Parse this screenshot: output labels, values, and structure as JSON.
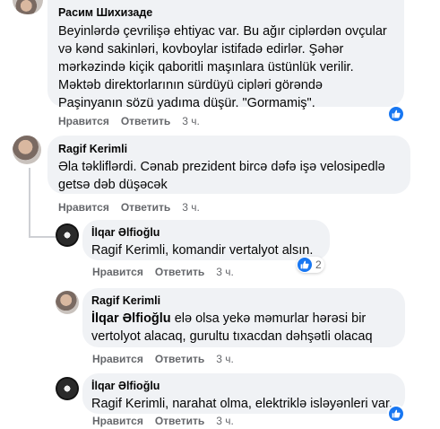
{
  "comments": [
    {
      "author": "Расим Шихизаде",
      "lines": [
        "Beyinlərdə çevrilişə ehtiyac var. Bu ağır ciplərdən ovçular",
        "və kənd sakinləri, kovboylar istifadə edirlər. Şəhər",
        "mərkəzində kiçik qaboritli maşınlara üstünlük verilir.",
        "Məktəb direktorlarının sürdüyü cipləri görəndə",
        "Paşinyanın sözü yadıma düşür. \"Gormamiş\"."
      ],
      "actions": {
        "like": "Нравится",
        "reply": "Ответить",
        "time": "3 ч."
      }
    },
    {
      "author": "Ragif Kerimli",
      "lines": [
        "Əla təkliflərdi. Cənab prezident bircə dəfə işə velosipedlə",
        "getsə dəb düşəcək"
      ],
      "actions": {
        "like": "Нравится",
        "reply": "Ответить",
        "time": "3 ч."
      }
    },
    {
      "author": "İlqar Əlfioğlu",
      "lines": [
        "Ragif Kerimli, komandir vertalyot alsın."
      ],
      "reactions": "2",
      "actions": {
        "like": "Нравится",
        "reply": "Ответить",
        "time": "3 ч."
      }
    },
    {
      "author": "Ragif Kerimli",
      "mention": "İlqar Əlfioğlu",
      "lines": [
        " elə olsa yekə məmurlar hərəsi bir",
        "vertolyot alacaq, gurultu tıxacdan dəhşətli olacaq"
      ],
      "actions": {
        "like": "Нравится",
        "reply": "Ответить",
        "time": "3 ч."
      }
    },
    {
      "author": "İlqar Əlfioğlu",
      "lines": [
        "Ragif Kerimli, narahat olma, elektriklə isləyənleri var."
      ],
      "actions": {
        "like": "Нравится",
        "reply": "Ответить",
        "time": "3 ч."
      }
    }
  ],
  "colors": {
    "like_blue": "#1877f2",
    "bubble": "#f0f2f5",
    "meta": "#65676b"
  },
  "icons": {
    "like": "thumbs-up-icon"
  }
}
